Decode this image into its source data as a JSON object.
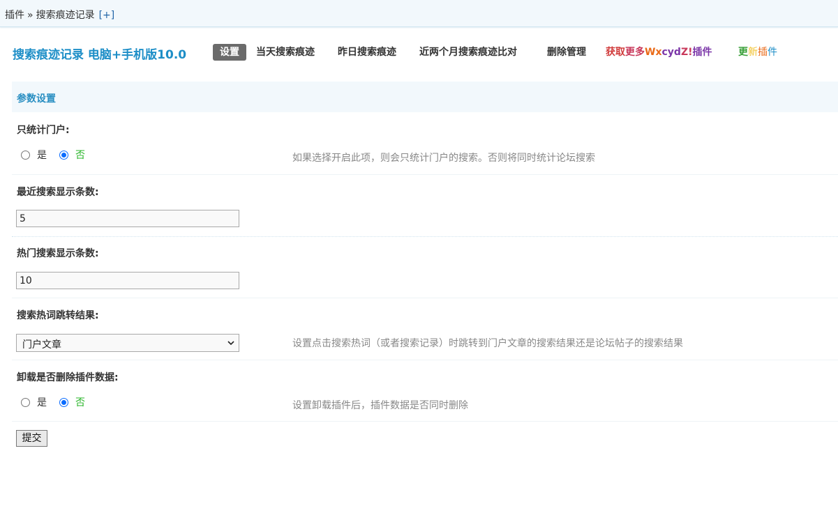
{
  "breadcrumb": {
    "root": "插件",
    "separator": "»",
    "current": "搜索痕迹记录",
    "add": "[+]"
  },
  "header": {
    "title": "搜索痕迹记录 电脑+手机版10.0",
    "tabs": [
      {
        "label": "设置",
        "active": true
      },
      {
        "label": "当天搜索痕迹"
      },
      {
        "label": "昨日搜索痕迹"
      },
      {
        "label": "近两个月搜索痕迹比对"
      },
      {
        "label": "删除管理"
      }
    ],
    "promo": {
      "p1": "获取",
      "p2": "更多",
      "p3": "Wx",
      "p4": "cyd",
      "p5": "Z!",
      "p6": "插件"
    },
    "update": {
      "u1": "更",
      "u2": "新",
      "u3": "插",
      "u4": "件"
    }
  },
  "section": {
    "title": "参数设置"
  },
  "settings": {
    "portal_only": {
      "label": "只统计门户:",
      "options": [
        "是",
        "否"
      ],
      "selected": "否",
      "tip": "如果选择开启此项，则会只统计门户的搜索。否则将同时统计论坛搜索"
    },
    "recent_count": {
      "label": "最近搜索显示条数:",
      "value": "5"
    },
    "hot_count": {
      "label": "热门搜索显示条数:",
      "value": "10"
    },
    "jump_target": {
      "label": "搜索热词跳转结果:",
      "value": "门户文章",
      "tip": "设置点击搜索热词（或者搜索记录）时跳转到门户文章的搜索结果还是论坛帖子的搜索结果"
    },
    "uninstall_delete": {
      "label": "卸载是否删除插件数据:",
      "options": [
        "是",
        "否"
      ],
      "selected": "否",
      "tip": "设置卸载插件后，插件数据是否同时删除"
    }
  },
  "submit_label": "提交",
  "colors": {
    "accent": "#1d8ec7",
    "section_bg": "#f2f8fc",
    "radio_selected": "#0a6cff",
    "selected_text": "#2ab52a"
  }
}
